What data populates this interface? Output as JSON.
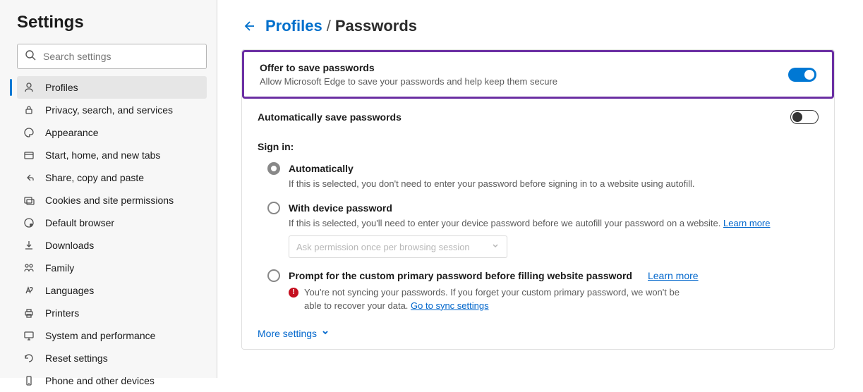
{
  "sidebar": {
    "title": "Settings",
    "search_placeholder": "Search settings",
    "items": [
      {
        "label": "Profiles",
        "icon": "user-icon",
        "active": true
      },
      {
        "label": "Privacy, search, and services",
        "icon": "lock-icon"
      },
      {
        "label": "Appearance",
        "icon": "appearance-icon"
      },
      {
        "label": "Start, home, and new tabs",
        "icon": "tabs-icon"
      },
      {
        "label": "Share, copy and paste",
        "icon": "share-icon"
      },
      {
        "label": "Cookies and site permissions",
        "icon": "cookies-icon"
      },
      {
        "label": "Default browser",
        "icon": "default-browser-icon"
      },
      {
        "label": "Downloads",
        "icon": "download-icon"
      },
      {
        "label": "Family",
        "icon": "family-icon"
      },
      {
        "label": "Languages",
        "icon": "languages-icon"
      },
      {
        "label": "Printers",
        "icon": "printer-icon"
      },
      {
        "label": "System and performance",
        "icon": "system-icon"
      },
      {
        "label": "Reset settings",
        "icon": "reset-icon"
      },
      {
        "label": "Phone and other devices",
        "icon": "phone-icon"
      }
    ]
  },
  "breadcrumb": {
    "parent": "Profiles",
    "separator": "/",
    "current": "Passwords"
  },
  "offer_save": {
    "title": "Offer to save passwords",
    "desc": "Allow Microsoft Edge to save your passwords and help keep them secure",
    "enabled": true
  },
  "auto_save": {
    "title": "Automatically save passwords",
    "enabled": false
  },
  "signin": {
    "heading": "Sign in:",
    "options": {
      "auto": {
        "label": "Automatically",
        "desc": "If this is selected, you don't need to enter your password before signing in to a website using autofill."
      },
      "device": {
        "label": "With device password",
        "desc": "If this is selected, you'll need to enter your device password before we autofill your password on a website.",
        "learn_more": "Learn more",
        "select_placeholder": "Ask permission once per browsing session"
      },
      "primary": {
        "label": "Prompt for the custom primary password before filling website password",
        "learn_more": "Learn more",
        "warn": "You're not syncing your passwords. If you forget your custom primary password, we won't be able to recover your data.",
        "sync_link": "Go to sync settings"
      }
    }
  },
  "more_settings": "More settings"
}
